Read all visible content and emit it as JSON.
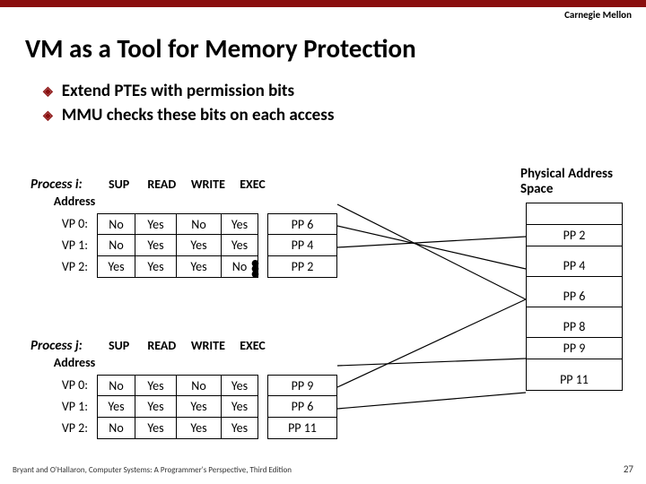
{
  "university": "Carnegie Mellon",
  "title": "VM as a Tool for Memory Protection",
  "bullets": [
    "Extend PTEs with permission bits",
    "MMU checks these bits on each access"
  ],
  "headers": {
    "sup": "SUP",
    "read": "READ",
    "write": "WRITE",
    "exec": "EXEC",
    "addr": "Address"
  },
  "process_i": {
    "name": "Process i:",
    "rows": [
      {
        "label": "VP 0:",
        "sup": "No",
        "read": "Yes",
        "write": "No",
        "exec": "Yes",
        "addr": "PP 6"
      },
      {
        "label": "VP 1:",
        "sup": "No",
        "read": "Yes",
        "write": "Yes",
        "exec": "Yes",
        "addr": "PP 4"
      },
      {
        "label": "VP 2:",
        "sup": "Yes",
        "read": "Yes",
        "write": "Yes",
        "exec": "No",
        "addr": "PP 2"
      }
    ]
  },
  "process_j": {
    "name": "Process j:",
    "rows": [
      {
        "label": "VP 0:",
        "sup": "No",
        "read": "Yes",
        "write": "No",
        "exec": "Yes",
        "addr": "PP 9"
      },
      {
        "label": "VP 1:",
        "sup": "Yes",
        "read": "Yes",
        "write": "Yes",
        "exec": "Yes",
        "addr": "PP 6"
      },
      {
        "label": "VP 2:",
        "sup": "No",
        "read": "Yes",
        "write": "Yes",
        "exec": "Yes",
        "addr": "PP 11"
      }
    ]
  },
  "phys_title": "Physical Address Space",
  "phys_pages": [
    "",
    "PP 2",
    "",
    "PP 4",
    "",
    "PP 6",
    "",
    "PP 8",
    "PP 9",
    "",
    "PP 11"
  ],
  "footer": "Bryant and O'Hallaron, Computer Systems: A Programmer's Perspective, Third Edition",
  "page": "27"
}
